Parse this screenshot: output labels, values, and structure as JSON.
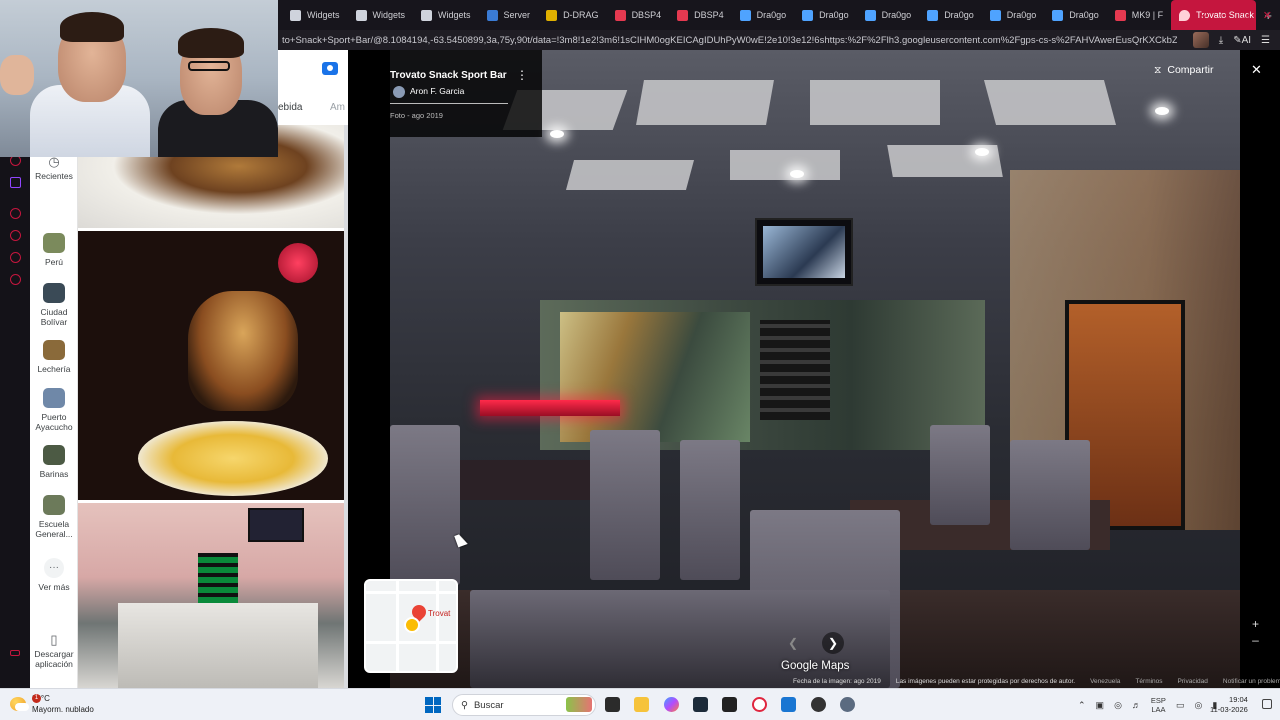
{
  "browser": {
    "tabs": [
      {
        "label": "Widgets",
        "color": "#cfd3dc"
      },
      {
        "label": "Widgets",
        "color": "#cfd3dc"
      },
      {
        "label": "Widgets",
        "color": "#cfd3dc"
      },
      {
        "label": "Server",
        "color": "#3a7bd5"
      },
      {
        "label": "D-DRAG",
        "color": "#e0b000"
      },
      {
        "label": "DBSP4",
        "color": "#e53950"
      },
      {
        "label": "DBSP4",
        "color": "#e53950"
      },
      {
        "label": "Dra0go",
        "color": "#4fa3ff"
      },
      {
        "label": "Dra0go",
        "color": "#4fa3ff"
      },
      {
        "label": "Dra0go",
        "color": "#4fa3ff"
      },
      {
        "label": "Dra0go",
        "color": "#4fa3ff"
      },
      {
        "label": "Dra0go",
        "color": "#4fa3ff"
      },
      {
        "label": "Dra0go",
        "color": "#4fa3ff"
      },
      {
        "label": "MK9 | F",
        "color": "#e53950"
      }
    ],
    "active_tab": "Trovato Snack",
    "new_tab": "+",
    "url": "to+Snack+Sport+Bar/@8.1084194,-63.5450899,3a,75y,90t/data=!3m8!1e2!3m6!1sCIHM0ogKEICAgIDUhPyW0wE!2e10!3e12!6shttps:%2F%2Flh3.googleusercontent.com%2Fgps-cs-s%2FAHVAwerEusQrKXCkbZCMhKC",
    "ai_label": "AI"
  },
  "rail": {
    "recent_label": "Recientes",
    "items": [
      {
        "label": "Perú",
        "color": "#7b8a5c"
      },
      {
        "label": "Ciudad Bolívar",
        "color": "#3a4a56"
      },
      {
        "label": "Lechería",
        "color": "#8a6a3a"
      },
      {
        "label": "Puerto Ayacucho",
        "color": "#6f88a8"
      },
      {
        "label": "Barinas",
        "color": "#4c5a44"
      },
      {
        "label": "Escuela General...",
        "color": "#6c7a5a"
      }
    ],
    "more_label": "Ver más",
    "download_label": "Descargar aplicación"
  },
  "panel": {
    "r_fragment": "r",
    "tab_fragment": "ebida",
    "tab_fragment2": "Am"
  },
  "viewer": {
    "place_title": "Trovato Snack Sport Bar",
    "author": "Aron F. Garcia",
    "photo_date": "Foto - ago 2019",
    "share_label": "Compartir",
    "minimap_label": "Trovat",
    "logo": "Google Maps",
    "footer": {
      "image_date": "Fecha de la imagen: ago 2019",
      "copyright": "Las imágenes pueden estar protegidas por derechos de autor.",
      "country": "Venezuela",
      "terms": "Términos",
      "privacy": "Privacidad",
      "report": "Notificar un problema"
    }
  },
  "taskbar": {
    "weather_temp": "30°C",
    "weather_desc": "Mayorm. nublado",
    "weather_badge": "1",
    "search_label": "Buscar",
    "lang_top": "ESP",
    "lang_bottom": "LAA",
    "time": "19:04",
    "date": "11-03-2026"
  },
  "colors": {
    "accent": "#c5163e",
    "taskbar": "#eef1f7"
  }
}
